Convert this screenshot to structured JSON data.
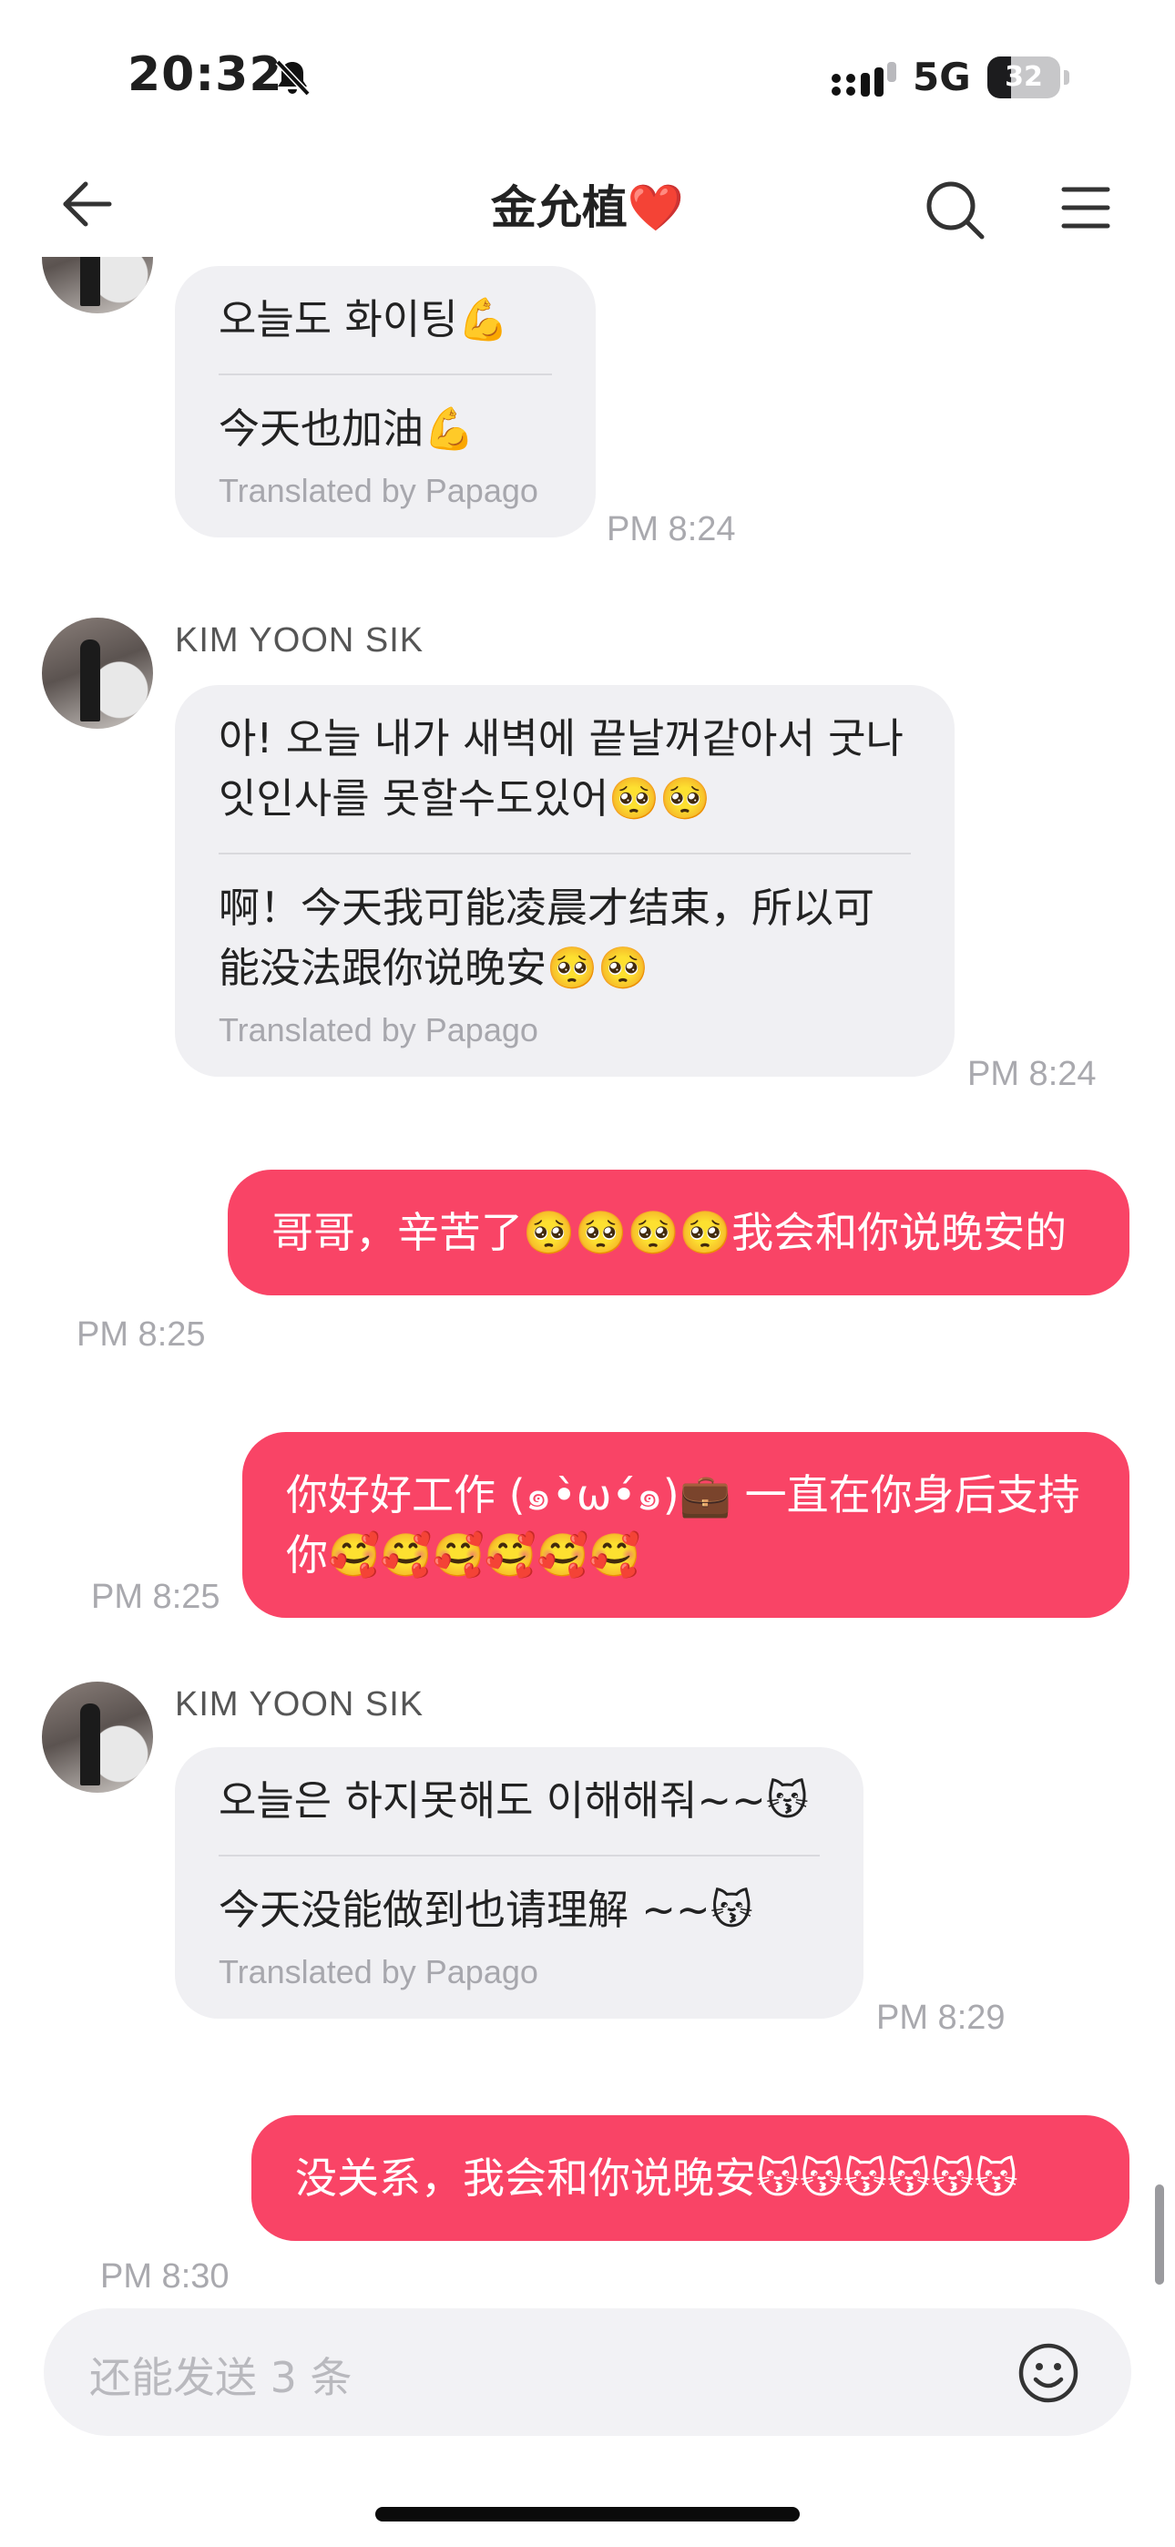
{
  "status_bar": {
    "time": "20:32",
    "network": "5G",
    "battery": "32",
    "battery_level": 0.32
  },
  "header": {
    "title": "金允植❤️"
  },
  "messages": [
    {
      "korean": "오늘도 화이팅💪",
      "chinese": "今天也加油💪",
      "translated_by": "Translated by Papago",
      "time": "PM 8:24"
    },
    {
      "sender": "KIM YOON SIK",
      "korean": "아! 오늘 내가 새벽에 끝날꺼같아서 굿나잇인사를 못할수도있어🥺🥺",
      "chinese": "啊！今天我可能凌晨才结束，所以可能没法跟你说晚安🥺🥺",
      "translated_by": "Translated by Papago",
      "time": "PM 8:24"
    },
    {
      "text": "哥哥，辛苦了🥺🥺🥺🥺我会和你说晚安的",
      "time": "PM 8:25"
    },
    {
      "text": "你好好工作 (๑•̀ω•́๑)💼 一直在你身后支持你🥰🥰🥰🥰🥰🥰",
      "time": "PM 8:25"
    },
    {
      "sender": "KIM YOON SIK",
      "korean": "오늘은 하지못해도 이해해줘~~😽",
      "chinese": "今天没能做到也请理解 ~~😽",
      "translated_by": "Translated by Papago",
      "time": "PM 8:29"
    },
    {
      "text": "没关系，我会和你说晚安😽😽😽😽😽😽",
      "time": "PM 8:30"
    }
  ],
  "input": {
    "placeholder": "还能发送 3 条"
  },
  "icons": {
    "back": "arrow-left-icon",
    "search": "search-icon",
    "menu": "menu-icon",
    "emoji": "emoji-icon",
    "bell": "bell-slash-icon",
    "signal": "signal-icon",
    "battery": "battery-icon"
  },
  "colors": {
    "outgoing_bubble": "#f94466",
    "incoming_bubble": "#f0f0f3",
    "timestamp": "#a9a9ae"
  }
}
